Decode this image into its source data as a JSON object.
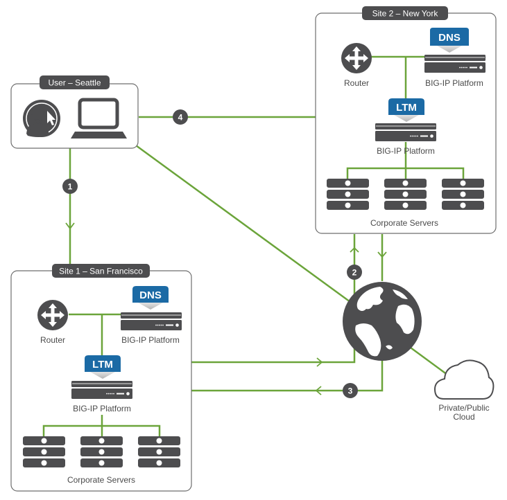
{
  "colors": {
    "link": "#6ba43a",
    "dark": "#4d4d4f",
    "badge": "#1b6aa5",
    "box_border": "#6d6d6d"
  },
  "user_site": {
    "title": "User – Seattle",
    "icons": [
      "user-cursor-icon",
      "laptop-icon"
    ]
  },
  "site2": {
    "title": "Site 2 – New York",
    "router_label": "Router",
    "dns_badge": "DNS",
    "dns_platform_label": "BIG-IP Platform",
    "ltm_badge": "LTM",
    "ltm_platform_label": "BIG-IP Platform",
    "servers_label": "Corporate Servers"
  },
  "site1": {
    "title": "Site 1 – San Francisco",
    "router_label": "Router",
    "dns_badge": "DNS",
    "dns_platform_label": "BIG-IP Platform",
    "ltm_badge": "LTM",
    "ltm_platform_label": "BIG-IP Platform",
    "servers_label": "Corporate Servers"
  },
  "internet": {
    "icon": "globe-icon"
  },
  "cloud": {
    "label_line1": "Private/Public",
    "label_line2": "Cloud"
  },
  "steps": [
    "1",
    "2",
    "3",
    "4"
  ]
}
